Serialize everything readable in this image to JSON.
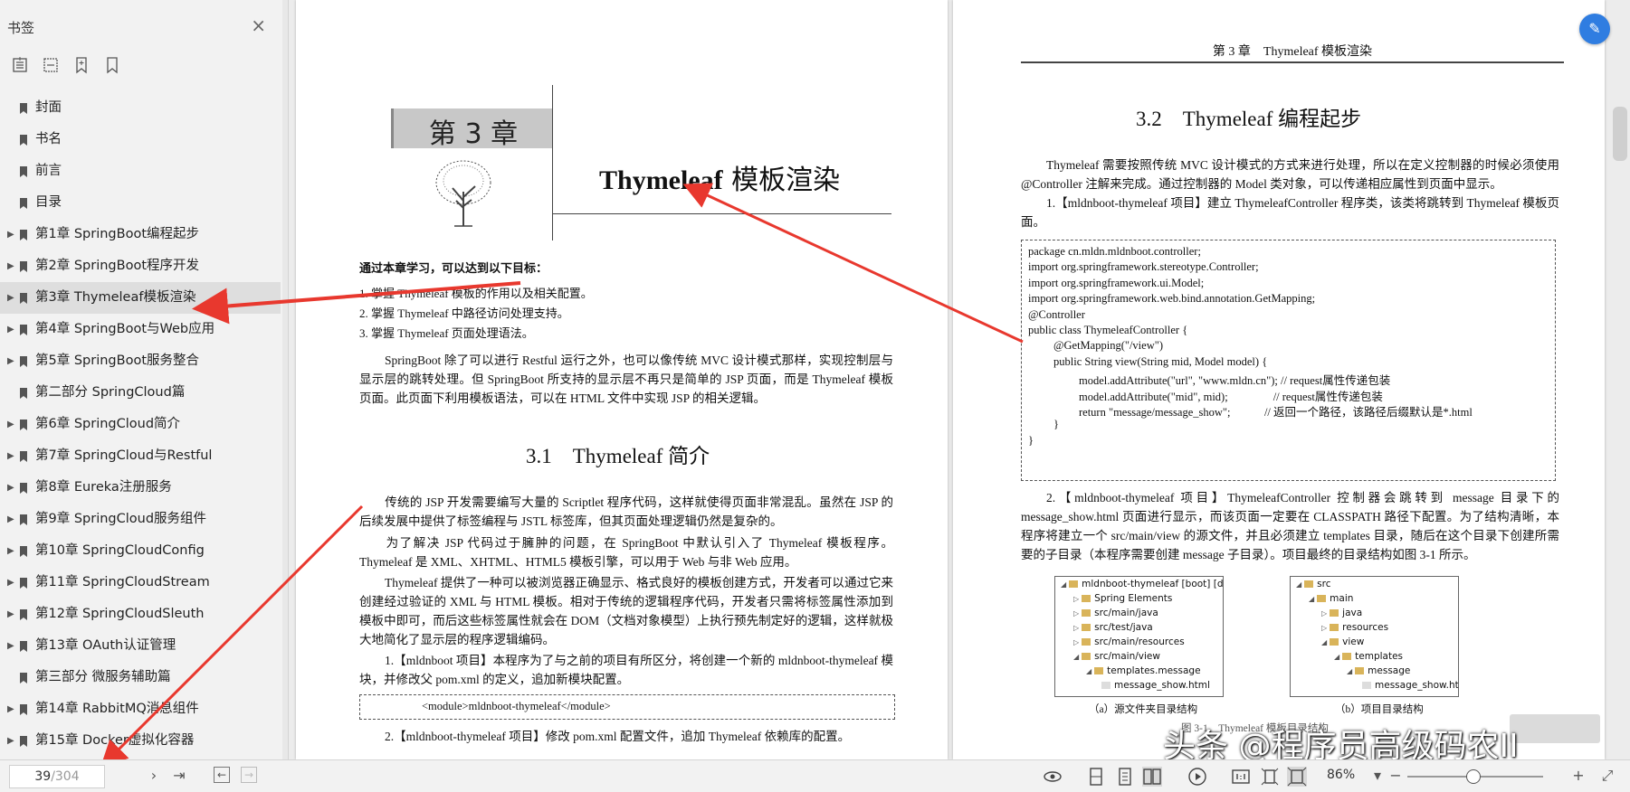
{
  "sidebar": {
    "title": "书签",
    "close_icon": "×",
    "items": [
      {
        "label": "封面",
        "expandable": false
      },
      {
        "label": "书名",
        "expandable": false
      },
      {
        "label": "前言",
        "expandable": false
      },
      {
        "label": "目录",
        "expandable": false
      },
      {
        "label": "第1章 SpringBoot编程起步",
        "expandable": true
      },
      {
        "label": "第2章 SpringBoot程序开发",
        "expandable": true
      },
      {
        "label": "第3章 Thymeleaf模板渲染",
        "expandable": true,
        "active": true
      },
      {
        "label": "第4章 SpringBoot与Web应用",
        "expandable": true
      },
      {
        "label": "第5章 SpringBoot服务整合",
        "expandable": true
      },
      {
        "label": "第二部分 SpringCloud篇",
        "expandable": false
      },
      {
        "label": "第6章 SpringCloud简介",
        "expandable": true
      },
      {
        "label": "第7章 SpringCloud与Restful",
        "expandable": true
      },
      {
        "label": "第8章 Eureka注册服务",
        "expandable": true
      },
      {
        "label": "第9章 SpringCloud服务组件",
        "expandable": true
      },
      {
        "label": "第10章 SpringCloudConfig",
        "expandable": true
      },
      {
        "label": "第11章 SpringCloudStream",
        "expandable": true
      },
      {
        "label": "第12章 SpringCloudSleuth",
        "expandable": true
      },
      {
        "label": "第13章 OAuth认证管理",
        "expandable": true
      },
      {
        "label": "第三部分 微服务辅助篇",
        "expandable": false
      },
      {
        "label": "第14章 RabbitMQ消息组件",
        "expandable": true
      },
      {
        "label": "第15章 Docker虚拟化容器",
        "expandable": true
      }
    ]
  },
  "left_page": {
    "chapter_num": "第 3 章",
    "chapter_title_en": "Thymeleaf",
    "chapter_title_cn": " 模板渲染",
    "goals_heading": "通过本章学习，可以达到以下目标：",
    "goals": [
      "1. 掌握 Thymeleaf 模板的作用以及相关配置。",
      "2. 掌握 Thymeleaf 中路径访问处理支持。",
      "3. 掌握 Thymeleaf 页面处理语法。"
    ],
    "intro": "SpringBoot 除了可以进行 Restful 运行之外，也可以像传统 MVC 设计模式那样，实现控制层与显示层的跳转处理。但 SpringBoot 所支持的显示层不再只是简单的 JSP 页面，而是 Thymeleaf 模板页面。此页面下利用模板语法，可以在 HTML 文件中实现 JSP 的相关逻辑。",
    "section_title": "3.1　Thymeleaf 简介",
    "p1": "传统的 JSP 开发需要编写大量的 Scriptlet 程序代码，这样就使得页面非常混乱。虽然在 JSP 的后续发展中提供了标签编程与 JSTL 标签库，但其页面处理逻辑仍然是复杂的。",
    "p2": "为了解决 JSP 代码过于臃肿的问题，在 SpringBoot 中默认引入了 Thymeleaf 模板程序。Thymeleaf 是 XML、XHTML、HTML5 模板引擎，可以用于 Web 与非 Web 应用。",
    "p3": "Thymeleaf 提供了一种可以被浏览器正确显示、格式良好的模板创建方式，开发者可以通过它来创建经过验证的 XML 与 HTML 模板。相对于传统的逻辑程序代码，开发者只需将标签属性添加到模板中即可，而后这些标签属性就会在 DOM（文档对象模型）上执行预先制定好的逻辑，这样就极大地简化了显示层的程序逻辑编码。",
    "p4": "1.【mldnboot 项目】本程序为了与之前的项目有所区分，将创建一个新的 mldnboot-thymeleaf 模块，并修改父 pom.xml 的定义，追加新模块配置。",
    "code1": "<module>mldnboot-thymeleaf</module>",
    "p5": "2.【mldnboot-thymeleaf 项目】修改 pom.xml 配置文件，追加 Thymeleaf 依赖库的配置。"
  },
  "right_page": {
    "running_head": "第 3 章　Thymeleaf 模板渲染",
    "section_title": "3.2　Thymeleaf 编程起步",
    "p1": "Thymeleaf 需要按照传统 MVC 设计模式的方式来进行处理，所以在定义控制器的时候必须使用 @Controller 注解来完成。通过控制器的 Model 类对象，可以传递相应属性到页面中显示。",
    "p2": "1.【mldnboot-thymeleaf 项目】建立 ThymeleafController 程序类，该类将跳转到 Thymeleaf 模板页面。",
    "code": [
      "package cn.mldn.mldnboot.controller;",
      "import org.springframework.stereotype.Controller;",
      "import org.springframework.ui.Model;",
      "import org.springframework.web.bind.annotation.GetMapping;",
      "@Controller",
      "public class ThymeleafController {",
      "@GetMapping(\"/view\")",
      "public String view(String mid, Model model) {",
      "model.addAttribute(\"url\", \"www.mldn.cn\"); // request属性传递包装",
      "model.addAttribute(\"mid\", mid);　　　　// request属性传递包装",
      "return \"message/message_show\";　　　//  返回一个路径，该路径后缀默认是*.html",
      "}",
      "}"
    ],
    "p3": "2.【mldnboot-thymeleaf 项目】ThymeleafController 控制器会跳转到 message 目录下的 message_show.html 页面进行显示，而该页面一定要在 CLASSPATH 路径下配置。为了结构清晰，本程序将建立一个 src/main/view 的源文件，并且必须建立 templates 目录，随后在这个目录下创建所需要的子目录（本程序需要创建 message 子目录）。项目最终的目录结构如图 3-1 所示。",
    "tree_a": [
      "mldnboot-thymeleaf [boot] [devtools]",
      "Spring Elements",
      "src/main/java",
      "src/test/java",
      "src/main/resources",
      "src/main/view",
      "templates.message",
      "message_show.html"
    ],
    "tree_b": [
      "src",
      "main",
      "java",
      "resources",
      "view",
      "templates",
      "message",
      "message_show.html"
    ],
    "caption_a": "（a）源文件夹目录结构",
    "caption_b": "（b）项目目录结构",
    "figure_caption": "图 3-1　Thymeleaf 模板目录结构"
  },
  "bottom_bar": {
    "current_page": "39",
    "total_pages": "/304",
    "zoom": "86%"
  },
  "watermark": "头条 @程序员高级码农II",
  "colors": {
    "accent": "#2f7de1",
    "arrow": "#e8382e"
  }
}
